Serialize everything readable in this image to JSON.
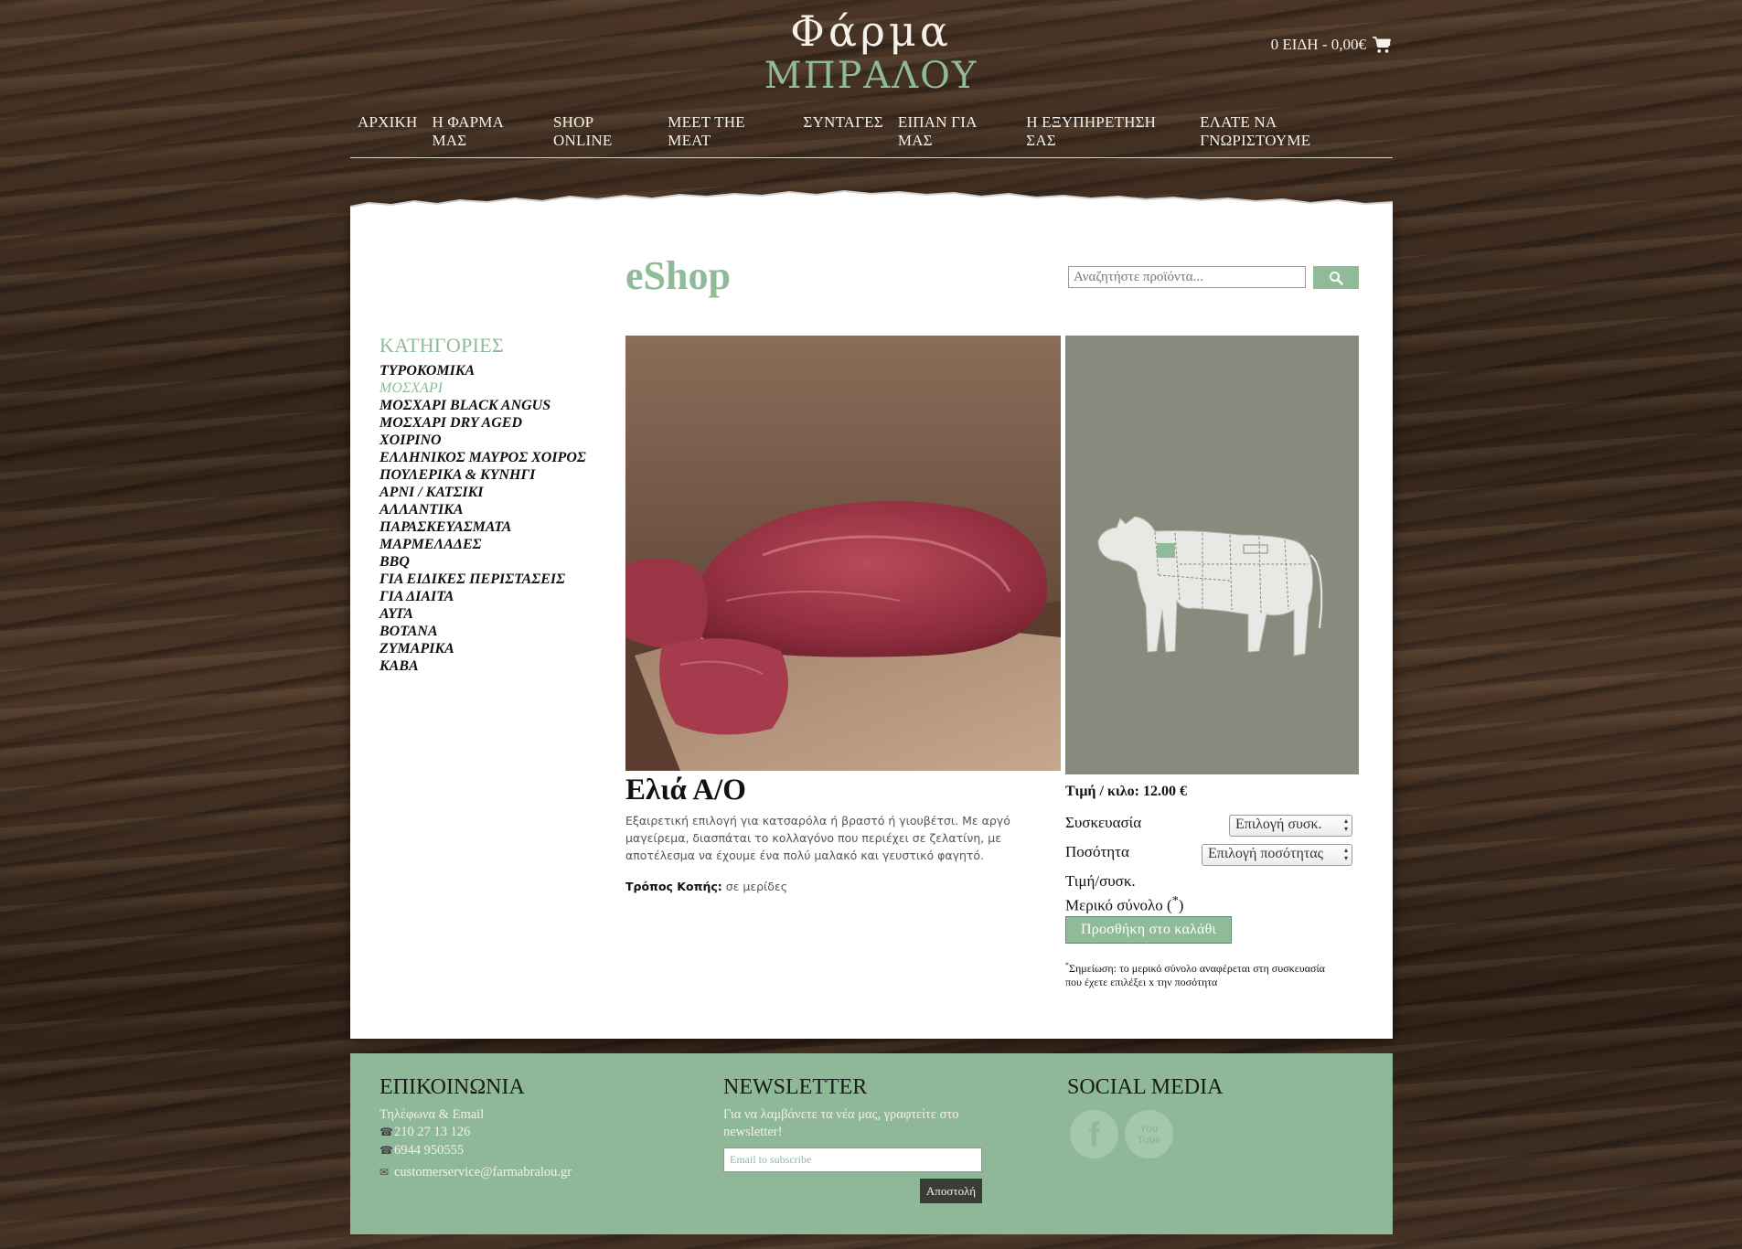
{
  "header": {
    "logo_line1": "ΦάρμαΜΠΡΑΛΟΥ",
    "logo_top": "Φάρμα",
    "logo_bottom": "ΜΠΡΑΛΟΥ",
    "cart_text": "0 ΕΙΔΗ - 0,00€",
    "cart_icon": "cart-icon",
    "nav": [
      "ΑΡΧΙΚΗ",
      "Η ΦΑΡΜΑ ΜΑΣ",
      "SHOP ONLINE",
      "MEET THE MEAT",
      "ΣΥΝΤΑΓΕΣ",
      "ΕΙΠΑΝ ΓΙΑ ΜΑΣ",
      "Η ΕΞΥΠΗΡΕΤΗΣΗ ΣΑΣ",
      "ΕΛΑΤΕ ΝΑ ΓΝΩΡΙΣΤΟΥΜΕ"
    ]
  },
  "shop": {
    "title": "eShop",
    "search_placeholder": "Αναζητήστε προϊόντα...",
    "search_icon": "search-icon"
  },
  "categories": {
    "title": "ΚΑΤΗΓΟΡΙΕΣ",
    "active": "ΜΟΣΧΑΡΙ",
    "items": [
      "ΤΥΡΟΚΟΜΙΚΑ",
      "ΜΟΣΧΑΡΙ",
      "ΜΟΣΧΑΡΙ BLACK ANGUS",
      "ΜΟΣΧΑΡΙ DRY AGED",
      "ΧΟΙΡΙΝΟ",
      "ΕΛΛΗΝΙΚΟΣ ΜΑΥΡΟΣ ΧΟΙΡΟΣ",
      "ΠΟΥΛΕΡΙΚΑ & ΚΥΝΗΓΙ",
      "ΑΡΝΙ / ΚΑΤΣΙΚΙ",
      "ΑΛΛΑΝΤΙΚΑ",
      "ΠΑΡΑΣΚΕΥΑΣΜΑΤΑ",
      "ΜΑΡΜΕΛΑΔΕΣ",
      "BBQ",
      "ΓΙΑ ΕΙΔΙΚΕΣ ΠΕΡΙΣΤΑΣΕΙΣ",
      "ΓΙΑ ΔΙΑΙΤΑ",
      "ΑΥΓΑ",
      "ΒΟΤΑΝΑ",
      "ΖΥΜΑΡΙΚΑ",
      "ΚΑΒΑ"
    ]
  },
  "product": {
    "name": "Ελιά Α/Ο",
    "description": "Εξαιρετική επιλογή για κατσαρόλα ή βραστό ή γιουβέτσι. Με αργό μαγείρεμα, διασπάται το κολλαγόνο που περιέχει σε ζελατίνη, με αποτέλεσμα να έχουμε ένα πολύ μαλακό και γευστικό φαγητό.",
    "cut_label": "Τρόπος Κοπής:",
    "cut_value": "σε μερίδες",
    "price_per_kilo": "Τιμή / κιλο: 12.00 €",
    "packaging_label": "Συσκευασία",
    "packaging_select": "Επιλογή συσκ.",
    "quantity_label": "Ποσότητα",
    "quantity_select": "Επιλογή ποσότητας",
    "unit_price_label": "Τιμή/συσκ.",
    "subtotal_label": "Μερικό σύνολο (",
    "subtotal_star": "*",
    "subtotal_close": ")",
    "add_to_cart": "Προσθήκη στο καλάθι",
    "note_star": "*",
    "note": "Σημείωση: το μερικό σύνολο αναφέρεται στη συσκευασία που έχετε επιλέξει x την ποσότητα"
  },
  "footer": {
    "contact_title": "ΕΠΙΚΟΙΝΩΝΙΑ",
    "contact_subtitle": "Τηλέφωνα & Email",
    "phone1": "210 27 13 126",
    "phone2": "6944 950555",
    "email": "customerservice@farmabralou.gr",
    "newsletter_title": "NEWSLETTER",
    "newsletter_text": "Για να λαμβάνετε τα νέα μας, γραφτείτε στο newsletter!",
    "newsletter_placeholder": "Email to subscribe",
    "newsletter_button": "Αποστολή",
    "social_title": "SOCIAL MEDIA",
    "facebook_icon": "facebook-icon",
    "youtube_icon": "youtube-icon",
    "facebook_glyph": "f",
    "youtube_glyph_top": "You",
    "youtube_glyph_bottom": "Tube"
  }
}
